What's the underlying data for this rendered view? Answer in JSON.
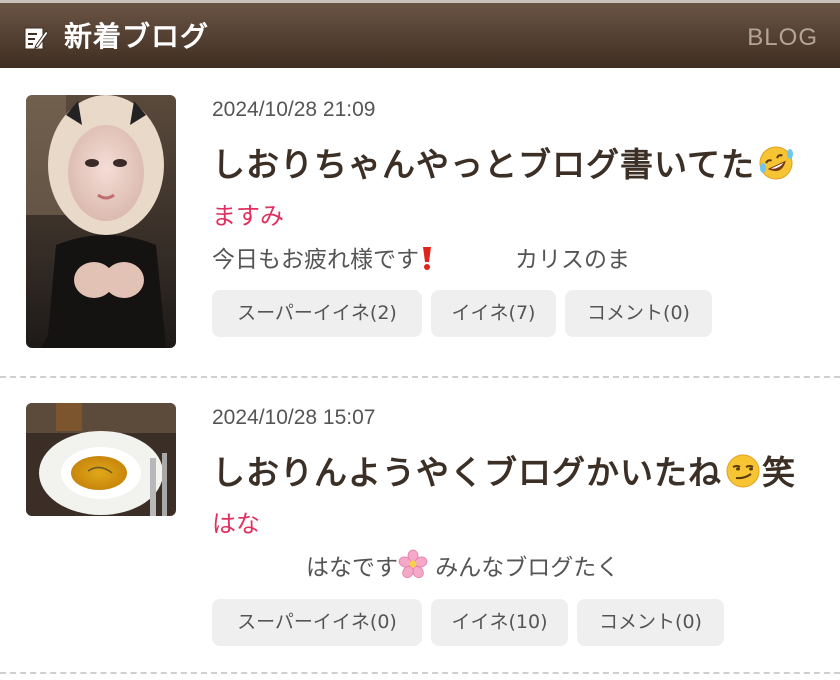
{
  "header": {
    "title": "新着ブログ",
    "link_label": "BLOG",
    "icon": "edit-note-icon",
    "colors": {
      "bar_top": "#6a5444",
      "bar_bottom": "#3f2e22",
      "link": "#b3a596"
    }
  },
  "entries": [
    {
      "thumbnail": "portrait-photo",
      "date": "2024/10/28 21:09",
      "title": "しおりちゃんやっとブログ書いてた",
      "title_emoji": "rolling-on-floor-laughing-emoji",
      "author": "ますみ",
      "excerpt_a": "今日もお疲れ様です",
      "excerpt_icon": "red-exclamation-icon",
      "excerpt_b": "カリスのま",
      "buttons": {
        "super_like": "スーパーイイネ(2)",
        "like": "イイネ(7)",
        "comment": "コメント(0)"
      }
    },
    {
      "thumbnail": "soup-bowl-photo",
      "date": "2024/10/28 15:07",
      "title": "しおりんようやくブログかいたね",
      "title_emoji": "smirking-face-emoji",
      "title_suffix": "笑",
      "author": "はな",
      "excerpt_a": "はなです",
      "excerpt_icon": "cherry-blossom-icon",
      "excerpt_b": " みんなブログたく",
      "buttons": {
        "super_like": "スーパーイイネ(0)",
        "like": "イイネ(10)",
        "comment": "コメント(0)"
      }
    }
  ],
  "colors": {
    "author": "#e03060",
    "button_bg": "#efefef",
    "title": "#3c2f25"
  }
}
